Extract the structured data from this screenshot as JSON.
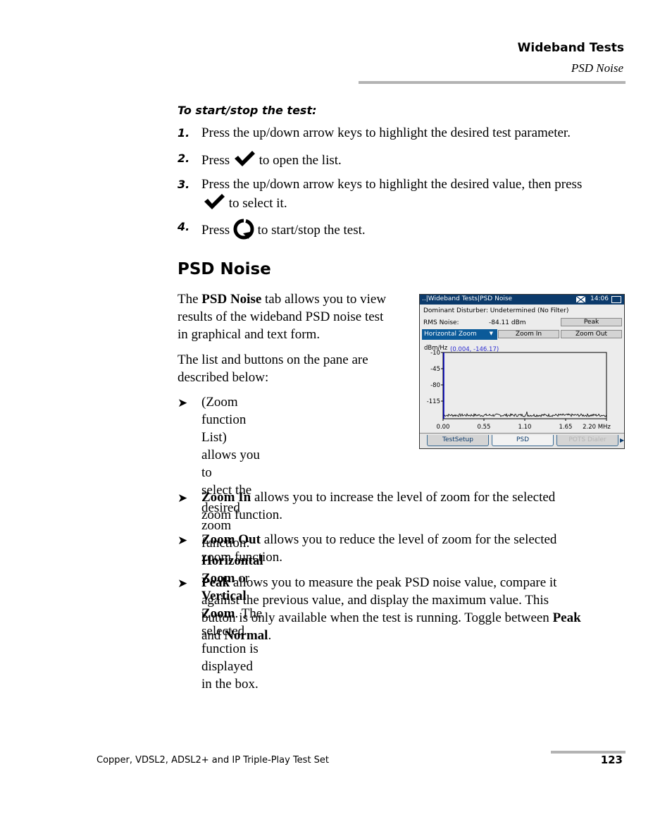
{
  "header": {
    "chapter": "Wideband Tests",
    "section": "PSD Noise"
  },
  "procedure": {
    "heading": "To start/stop the test:",
    "steps": [
      {
        "num": "1.",
        "text": "Press the up/down arrow keys to highlight the desired test parameter."
      },
      {
        "num": "2.",
        "before": "Press",
        "icon": "checkmark-icon",
        "after": "to open the list."
      },
      {
        "num": "3.",
        "line1": "Press the up/down arrow keys to highlight the desired value, then press",
        "icon": "checkmark-icon",
        "line2": "to select it."
      },
      {
        "num": "4.",
        "before": "Press",
        "icon": "start-stop-icon",
        "after": "to start/stop the test."
      }
    ]
  },
  "section": {
    "title": "PSD Noise",
    "intro": {
      "pre": "The ",
      "bold": "PSD Noise",
      "post_l1": " tab allows you to view",
      "l2": "results of the wideband PSD noise test",
      "l3": "in graphical and text form."
    },
    "list_intro": {
      "l1": "The list and buttons on the pane are",
      "l2": "described below:"
    },
    "bullets": [
      {
        "lines": [
          [
            "(Zoom function List) allows you to"
          ],
          [
            "select the desired zoom function:"
          ],
          [
            {
              "b": "Horizontal Zoom"
            },
            " or ",
            {
              "b": "Vertical"
            }
          ],
          [
            {
              "b": "Zoom"
            },
            ". The selected function is"
          ],
          [
            "displayed in the box."
          ]
        ]
      },
      {
        "bold": "Zoom In",
        "l1": " allows you to increase the level of zoom for the selected",
        "l2": "zoom function."
      },
      {
        "bold": "Zoom Out",
        "l1": " allows you to reduce the level of zoom for the selected",
        "l2": "zoom function."
      },
      {
        "bold": "Peak",
        "l1": " allows you to measure the peak PSD noise value, compare it",
        "l2": "against the previous value, and display the maximum value. This",
        "l3": "button is only available when the test is running. Toggle between ",
        "l3_bold": "Peak",
        "l4_pre": "and ",
        "l4_bold": "Normal",
        "l4_post": "."
      }
    ]
  },
  "device": {
    "title": "..|Wideband Tests|PSD Noise",
    "clock": "14:06",
    "dominant_disturber": "Dominant Disturber: Undetermined  (No Filter)",
    "rms_label": "RMS Noise:",
    "rms_value": "-84.11 dBm",
    "peak_button": "Peak",
    "zoom_select": "Horizontal Zoom",
    "zoom_in_button": "Zoom In",
    "zoom_out_button": "Zoom Out",
    "plot": {
      "y_unit": "dBm/Hz",
      "cursor_readout": "(0.004, -146.17)",
      "y_ticks": [
        "-10",
        "-45",
        "-80",
        "-115"
      ],
      "x_ticks": [
        "0.00",
        "0.55",
        "1.10",
        "1.65",
        "2.20 MHz"
      ],
      "cursor_color": "#0000cc",
      "trace_color": "#000000"
    },
    "tabs": [
      {
        "label": "TestSetup",
        "state": "normal"
      },
      {
        "label": "PSD",
        "state": "active"
      },
      {
        "label": "POTS Dialer",
        "state": "disabled"
      }
    ]
  },
  "footer": {
    "product": "Copper, VDSL2, ADSL2+ and IP Triple-Play Test Set",
    "page_number": "123"
  }
}
